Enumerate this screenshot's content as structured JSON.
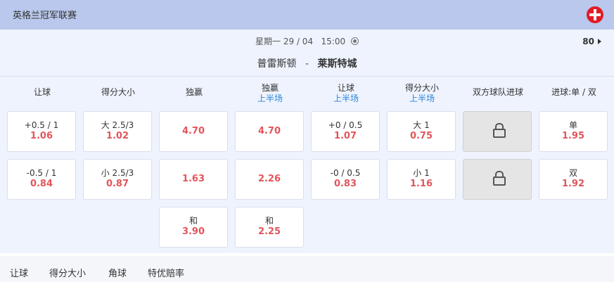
{
  "league": {
    "title": "英格兰冠军联赛",
    "flag_icon": "england-flag-icon"
  },
  "match": {
    "date": "星期一 29 / 04",
    "time": "15:00",
    "market_count": "80",
    "home": "普雷斯顿",
    "separator": "-",
    "away": "莱斯特城"
  },
  "columns": [
    {
      "label": "让球",
      "sub": ""
    },
    {
      "label": "得分大小",
      "sub": ""
    },
    {
      "label": "独赢",
      "sub": ""
    },
    {
      "label": "独赢",
      "sub": "上半场"
    },
    {
      "label": "让球",
      "sub": "上半场"
    },
    {
      "label": "得分大小",
      "sub": "上半场"
    },
    {
      "label": "双方球队进球",
      "sub": ""
    },
    {
      "label": "进球:单 / 双",
      "sub": ""
    }
  ],
  "odds": {
    "handicap": [
      {
        "line": "+0.5 / 1",
        "odd": "1.06"
      },
      {
        "line": "-0.5 / 1",
        "odd": "0.84"
      }
    ],
    "total": [
      {
        "line": "大 2.5/3",
        "odd": "1.02"
      },
      {
        "line": "小 2.5/3",
        "odd": "0.87"
      }
    ],
    "moneyline": [
      {
        "odd": "4.70"
      },
      {
        "odd": "1.63"
      },
      {
        "line": "和",
        "odd": "3.90"
      }
    ],
    "moneyline_1h": [
      {
        "odd": "4.70"
      },
      {
        "odd": "2.26"
      },
      {
        "line": "和",
        "odd": "2.25"
      }
    ],
    "handicap_1h": [
      {
        "line": "+0 / 0.5",
        "odd": "1.07"
      },
      {
        "line": "-0 / 0.5",
        "odd": "0.83"
      }
    ],
    "total_1h": [
      {
        "line": "大 1",
        "odd": "0.75"
      },
      {
        "line": "小 1",
        "odd": "1.16"
      }
    ],
    "odd_even": [
      {
        "line": "单",
        "odd": "1.95"
      },
      {
        "line": "双",
        "odd": "1.92"
      }
    ]
  },
  "colors": {
    "header": "#b9c8ec",
    "odds": "#e3555a",
    "sub_label": "#2a85d8"
  },
  "bottom_tabs": [
    "让球",
    "得分大小",
    "角球",
    "特优赔率"
  ]
}
